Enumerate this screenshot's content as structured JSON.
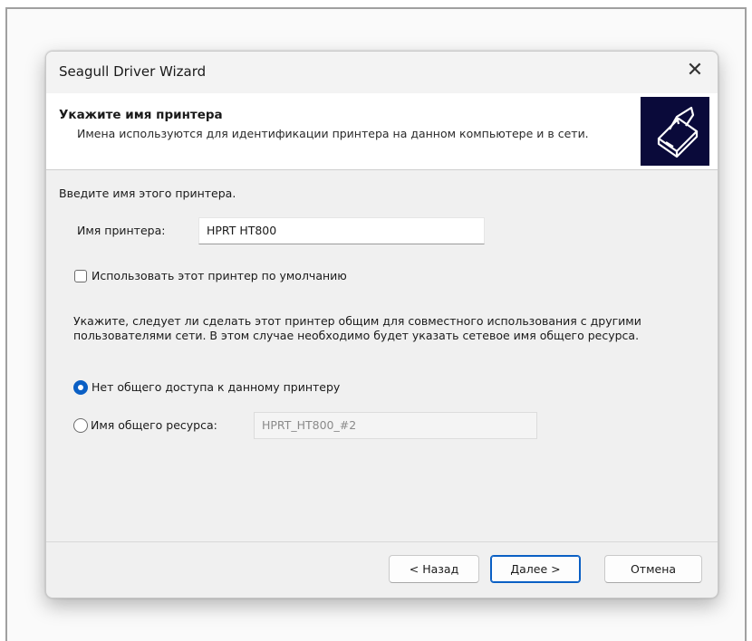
{
  "window": {
    "title": "Seagull Driver Wizard",
    "close_label": "✕"
  },
  "header": {
    "title": "Укажите имя принтера",
    "subtitle": "Имена используются для идентификации принтера на данном компьютере и в сети.",
    "icon": "printer-icon"
  },
  "form": {
    "intro": "Введите имя этого принтера.",
    "printer_name_label": "Имя принтера:",
    "printer_name_value": "HPRT HT800",
    "default_checkbox_label": "Использовать этот принтер по умолчанию",
    "default_checked": false,
    "share_description": "Укажите, следует ли сделать этот принтер общим для совместного использования с другими пользователями сети. В этом случае необходимо будет указать сетевое имя общего ресурса.",
    "no_share_label": "Нет общего доступа к данному принтеру",
    "no_share_selected": true,
    "share_name_label": "Имя общего ресурса:",
    "share_name_value": "HPRT_HT800_#2",
    "share_selected": false
  },
  "buttons": {
    "back": "< Назад",
    "next": "Далее >",
    "cancel": "Отмена"
  },
  "colors": {
    "accent": "#0a5fc4",
    "icon_bg": "#0a0a3a"
  }
}
